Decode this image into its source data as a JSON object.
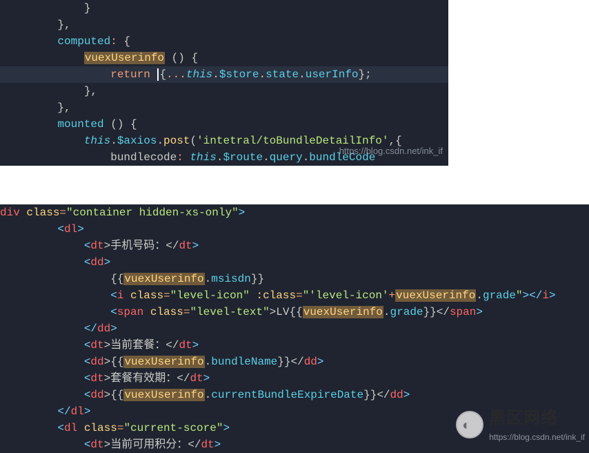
{
  "block1": {
    "l1a": "        }",
    "l2a": "    },",
    "l3_a": "    computed",
    "l3_b": ": ",
    "l3_c": "{",
    "l4_a": "        ",
    "l4_b": "vuexUserinfo",
    "l4_c": " () {",
    "l5_a": "            ",
    "l5_b": "return",
    "l5_c": " ",
    "l5_d": "{",
    "l5_e": "...",
    "l5_f": "this",
    "l5_g": ".",
    "l5_h": "$store",
    "l5_i": ".",
    "l5_j": "state",
    "l5_k": ".",
    "l5_l": "userInfo",
    "l5_m": "};",
    "l6a": "        },",
    "l7a": "    },",
    "l8_a": "    mounted",
    "l8_b": " () {",
    "l9_a": "        ",
    "l9_b": "this",
    "l9_c": ".",
    "l9_d": "$axios",
    "l9_e": ".",
    "l9_f": "post",
    "l9_g": "(",
    "l9_h": "'intetral/toBundleDetailInfo'",
    "l9_i": ",{",
    "l10_a": "            bundlecode",
    "l10_b": ": ",
    "l10_c": "this",
    "l10_d": ".",
    "l10_e": "$route",
    "l10_f": ".",
    "l10_g": "query",
    "l10_h": ".",
    "l10_i": "bundleCode",
    "wm": "https://blog.csdn.net/ink_if"
  },
  "block2": {
    "l1_a": "div",
    "l1_b": " class",
    "l1_c": "=",
    "l1_d": "\"container hidden-xs-only\"",
    "l1_e": ">",
    "l2_a": "    <",
    "l2_b": "dl",
    "l2_c": ">",
    "l3_a": "        <",
    "l3_b": "dt",
    "l3_c": ">手机号码：</",
    "l3_d": "dt",
    "l3_e": ">",
    "l4_a": "        <",
    "l4_b": "dd",
    "l4_c": ">",
    "l5_a": "            {{",
    "l5_b": "vuexUserinfo",
    "l5_c": ".",
    "l5_d": "msisdn",
    "l5_e": "}}",
    "l6_a": "            <",
    "l6_b": "i",
    "l6_c": " class",
    "l6_d": "=",
    "l6_e": "\"level-icon\"",
    "l6_f": " :class",
    "l6_g": "=",
    "l6_h": "\"'level-icon'",
    "l6_i": "+",
    "l6_j": "vuexUserinfo",
    "l6_k": ".",
    "l6_l": "grade",
    "l6_m": "\"",
    "l6_n": "></",
    "l6_o": "i",
    "l6_p": ">",
    "l7_a": "            <",
    "l7_b": "span",
    "l7_c": " class",
    "l7_d": "=",
    "l7_e": "\"level-text\"",
    "l7_f": ">LV{{",
    "l7_g": "vuexUserinfo",
    "l7_h": ".",
    "l7_i": "grade",
    "l7_j": "}}</",
    "l7_k": "span",
    "l7_l": ">",
    "l8_a": "        </",
    "l8_b": "dd",
    "l8_c": ">",
    "l9_a": "        <",
    "l9_b": "dt",
    "l9_c": ">当前套餐：</",
    "l9_d": "dt",
    "l9_e": ">",
    "l10_a": "        <",
    "l10_b": "dd",
    "l10_c": ">{{",
    "l10_d": "vuexUserinfo",
    "l10_e": ".",
    "l10_f": "bundleName",
    "l10_g": "}}</",
    "l10_h": "dd",
    "l10_i": ">",
    "l11_a": "        <",
    "l11_b": "dt",
    "l11_c": ">套餐有效期：</",
    "l11_d": "dt",
    "l11_e": ">",
    "l12_a": "        <",
    "l12_b": "dd",
    "l12_c": ">{{",
    "l12_d": "vuexUserinfo",
    "l12_e": ".",
    "l12_f": "currentBundleExpireDate",
    "l12_g": "}}</",
    "l12_h": "dd",
    "l12_i": ">",
    "l13_a": "    </",
    "l13_b": "dl",
    "l13_c": ">",
    "l14_a": "    <",
    "l14_b": "dl",
    "l14_c": " class",
    "l14_d": "=",
    "l14_e": "\"current-score\"",
    "l14_f": ">",
    "l15_a": "        <",
    "l15_b": "dt",
    "l15_c": ">当前可用积分：</",
    "l15_d": "dt",
    "l15_e": ">",
    "wm_big": "黑区网络",
    "wm_url": "https://blog.csdn.net/ink_if"
  }
}
